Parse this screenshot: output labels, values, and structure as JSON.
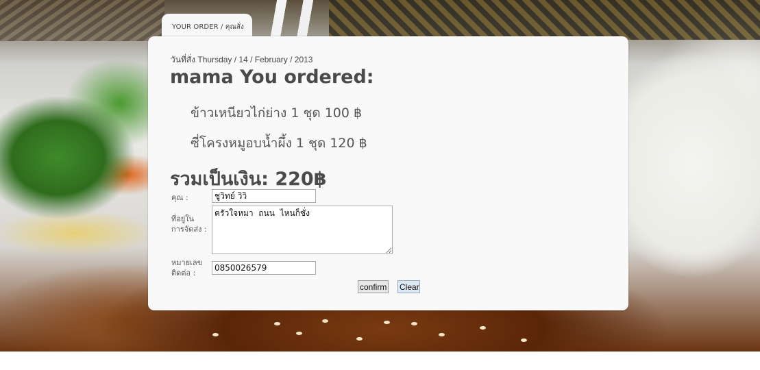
{
  "tab": {
    "label": "YOUR ORDER / คุณสั่ง"
  },
  "order": {
    "date_label": "วันที่สั่ง",
    "date": "Thursday / 14 / February / 2013",
    "heading": "mama You ordered:",
    "items": [
      {
        "text": "ข้าวเหนียวไก่ย่าง 1 ชุด 100 ฿"
      },
      {
        "text": "ซี่โครงหมูอบน้ำผึ้ง 1 ชุด 120 ฿"
      }
    ],
    "total": "รวมเป็นเงิน: 220฿"
  },
  "form": {
    "name_label": "คุณ :",
    "name_value": "ชูวิทย์ วิวิ",
    "address_label": "ที่อยู่ใน การจัดส่ง :",
    "address_value": "ครัวใจหมา  ถนน  ไหนก็ชั่ง",
    "phone_label": "หมายเลข ติดต่อ :",
    "phone_value": "0850026579",
    "confirm_label": "confirm",
    "clear_label": "Clear"
  }
}
